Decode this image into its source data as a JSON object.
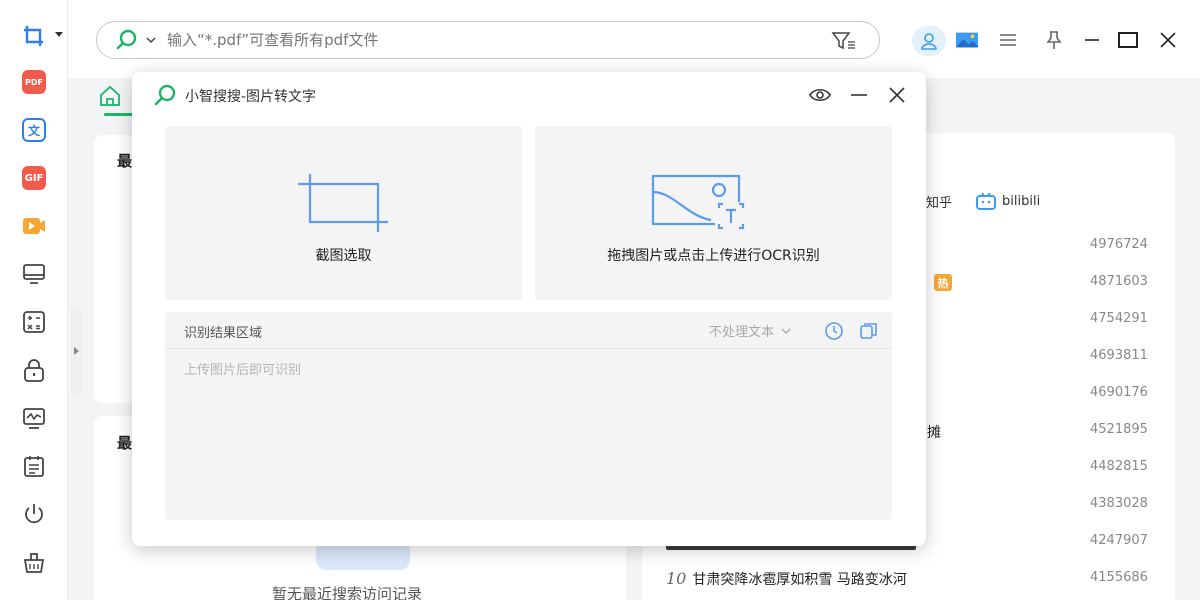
{
  "search": {
    "placeholder": "输入“*.pdf”可查看所有pdf文件"
  },
  "rail": {
    "items": [
      {
        "icon": "screenshot-icon"
      },
      {
        "icon": "pdf-icon",
        "label": "PDF"
      },
      {
        "icon": "translate-icon",
        "label": "文"
      },
      {
        "icon": "gif-icon",
        "label": "GIF"
      },
      {
        "icon": "video-icon"
      },
      {
        "icon": "monitor-icon"
      },
      {
        "icon": "calculator-icon"
      },
      {
        "icon": "lock-icon"
      },
      {
        "icon": "performance-icon"
      },
      {
        "icon": "calendar-icon"
      },
      {
        "icon": "power-icon"
      },
      {
        "icon": "cleanup-icon"
      }
    ]
  },
  "dialog": {
    "title": "小智搜搜-图片转文字",
    "crop_label": "截图选取",
    "ocr_label": "拖拽图片或点击上传进行OCR识别",
    "result_title": "识别结果区域",
    "mode_value": "不处理文本",
    "result_placeholder": "上传图片后即可识别"
  },
  "background": {
    "left_frag_1": "最",
    "left_frag_2": "最",
    "empty_text": "暂无最近搜索访问记录",
    "sources": {
      "zhihu": "知乎",
      "bilibili": "bilibili"
    },
    "hot_badge": "热",
    "frag_char": "摊",
    "rank_numbers": [
      "4976724",
      "4871603",
      "4754291",
      "4693811",
      "4690176",
      "4521895",
      "4482815",
      "4383028",
      "4247907",
      "4155686"
    ],
    "row10": {
      "index": "10",
      "text": "甘肃突降冰雹厚如积雪 马路变冰河"
    }
  },
  "colors": {
    "accent_green": "#1cb467",
    "ocr_blue": "#5b9bf0",
    "hot_orange": "#f7a534"
  }
}
